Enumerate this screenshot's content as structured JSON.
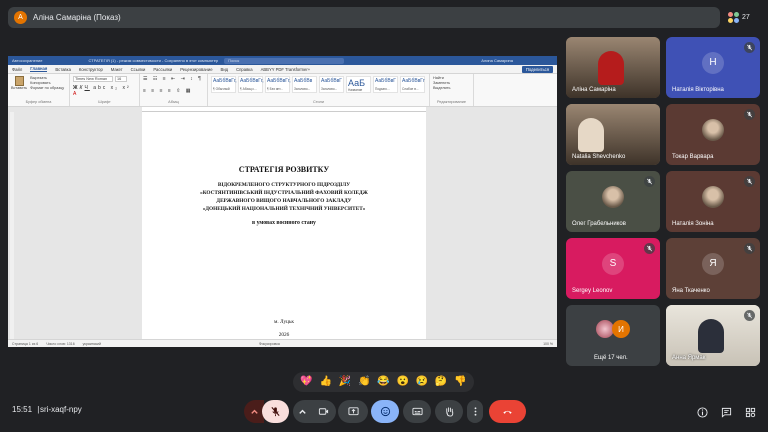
{
  "presenter_bar": {
    "avatar_letter": "А",
    "title": "Аліна Самаріна (Показ)"
  },
  "participants_count": "27",
  "word": {
    "titlebar": {
      "autosave": "Автосохранение",
      "doc_name": "СТРАТЕГІЯ (1) - режим совместимости - Сохранено в этот компьютер",
      "search": "Поиск",
      "user": "Алина Самарина"
    },
    "tabs": [
      "Файл",
      "Главная",
      "Вставка",
      "Конструктор",
      "Макет",
      "Ссылки",
      "Рассылки",
      "Рецензирование",
      "Вид",
      "Справка",
      "ABBYY PDF Transformer+"
    ],
    "active_tab": "Главная",
    "share_label": "Поделиться",
    "ribbon": {
      "paste": "Вставить",
      "cut": "Вырезать",
      "copy": "Копировать",
      "format_painter": "Формат по образцу",
      "clipboard_label": "Буфер обмена",
      "font_name": "Times New Roman",
      "font_size": "16",
      "font_label": "Шрифт",
      "paragraph_label": "Абзац",
      "styles": [
        {
          "preview": "АаБбВвГг,",
          "name": "¶ Обычный"
        },
        {
          "preview": "АаБбВвГг,",
          "name": "¶ Абзац с..."
        },
        {
          "preview": "АаБбВвГг,",
          "name": "¶ Без инт..."
        },
        {
          "preview": "АаБбВв",
          "name": "Заголово..."
        },
        {
          "preview": "АаБбВвГ",
          "name": "Заголово..."
        },
        {
          "preview": "АаБ",
          "name": "Название"
        },
        {
          "preview": "АаБбВвГ",
          "name": "Подзаго..."
        },
        {
          "preview": "АаБбВвГг",
          "name": "Слабое в..."
        }
      ],
      "styles_label": "Стили",
      "find": "Найти",
      "replace": "Заменить",
      "select": "Выделить",
      "editing_label": "Редактирование"
    },
    "document": {
      "title": "СТРАТЕГІЯ РОЗВИТКУ",
      "subtitle_lines": [
        "ВІДОКРЕМЛЕНОГО СТРУКТУРНОГО ПІДРОЗДІЛУ",
        "«КОСТЯНТИНІВСЬКИЙ ІНДУСТРІАЛЬНИЙ ФАХОВИЙ КОЛЕДЖ",
        "ДЕРЖАВНОГО ВИЩОГО НАВЧАЛЬНОГО ЗАКЛАДУ",
        "«ДОНЕЦЬКИЙ НАЦІОНАЛЬНИЙ ТЕХНІЧНИЙ УНІВЕРСИТЕТ»"
      ],
      "condition": "в умовах воєнного стану",
      "city": "м. Луцьк",
      "year": "2026"
    },
    "status": {
      "page": "Страница 1 из 6",
      "words": "Число слов: 1316",
      "language": "украинский",
      "focus": "Фокусировка",
      "zoom": "100 %"
    }
  },
  "participants": [
    {
      "name": "Аліна Самаріна",
      "type": "video",
      "muted": false
    },
    {
      "name": "Наталія Вікторівна",
      "type": "letter",
      "letter": "Н",
      "color": "#3f51b5",
      "muted": true
    },
    {
      "name": "Natalia Shevchenko",
      "type": "video",
      "muted": false
    },
    {
      "name": "Токар Варвара",
      "type": "photo",
      "muted": true
    },
    {
      "name": "Олег Грабельников",
      "type": "photo",
      "muted": true
    },
    {
      "name": "Наталія Зоніна",
      "type": "photo",
      "muted": true
    },
    {
      "name": "Sergey Leonov",
      "type": "letter",
      "letter": "S",
      "color": "#d81b60",
      "muted": true
    },
    {
      "name": "Яна Ткаченко",
      "type": "letter",
      "letter": "Я",
      "color": "#5d4037",
      "muted": true
    },
    {
      "name": "Ещё 17 чел.",
      "type": "more",
      "letter": "И",
      "muted": false
    },
    {
      "name": "Анна Ярмак",
      "type": "video",
      "muted": true
    }
  ],
  "reactions": [
    "💖",
    "👍",
    "🎉",
    "👏",
    "😂",
    "😮",
    "😢",
    "🤔",
    "👎"
  ],
  "meeting": {
    "time": "15:51",
    "separator": "|",
    "code": "sri-xaqf-npy"
  },
  "colors": {
    "background": "#202124",
    "accent": "#8ab4f8",
    "danger": "#ea4335",
    "word_blue": "#2b579a"
  }
}
